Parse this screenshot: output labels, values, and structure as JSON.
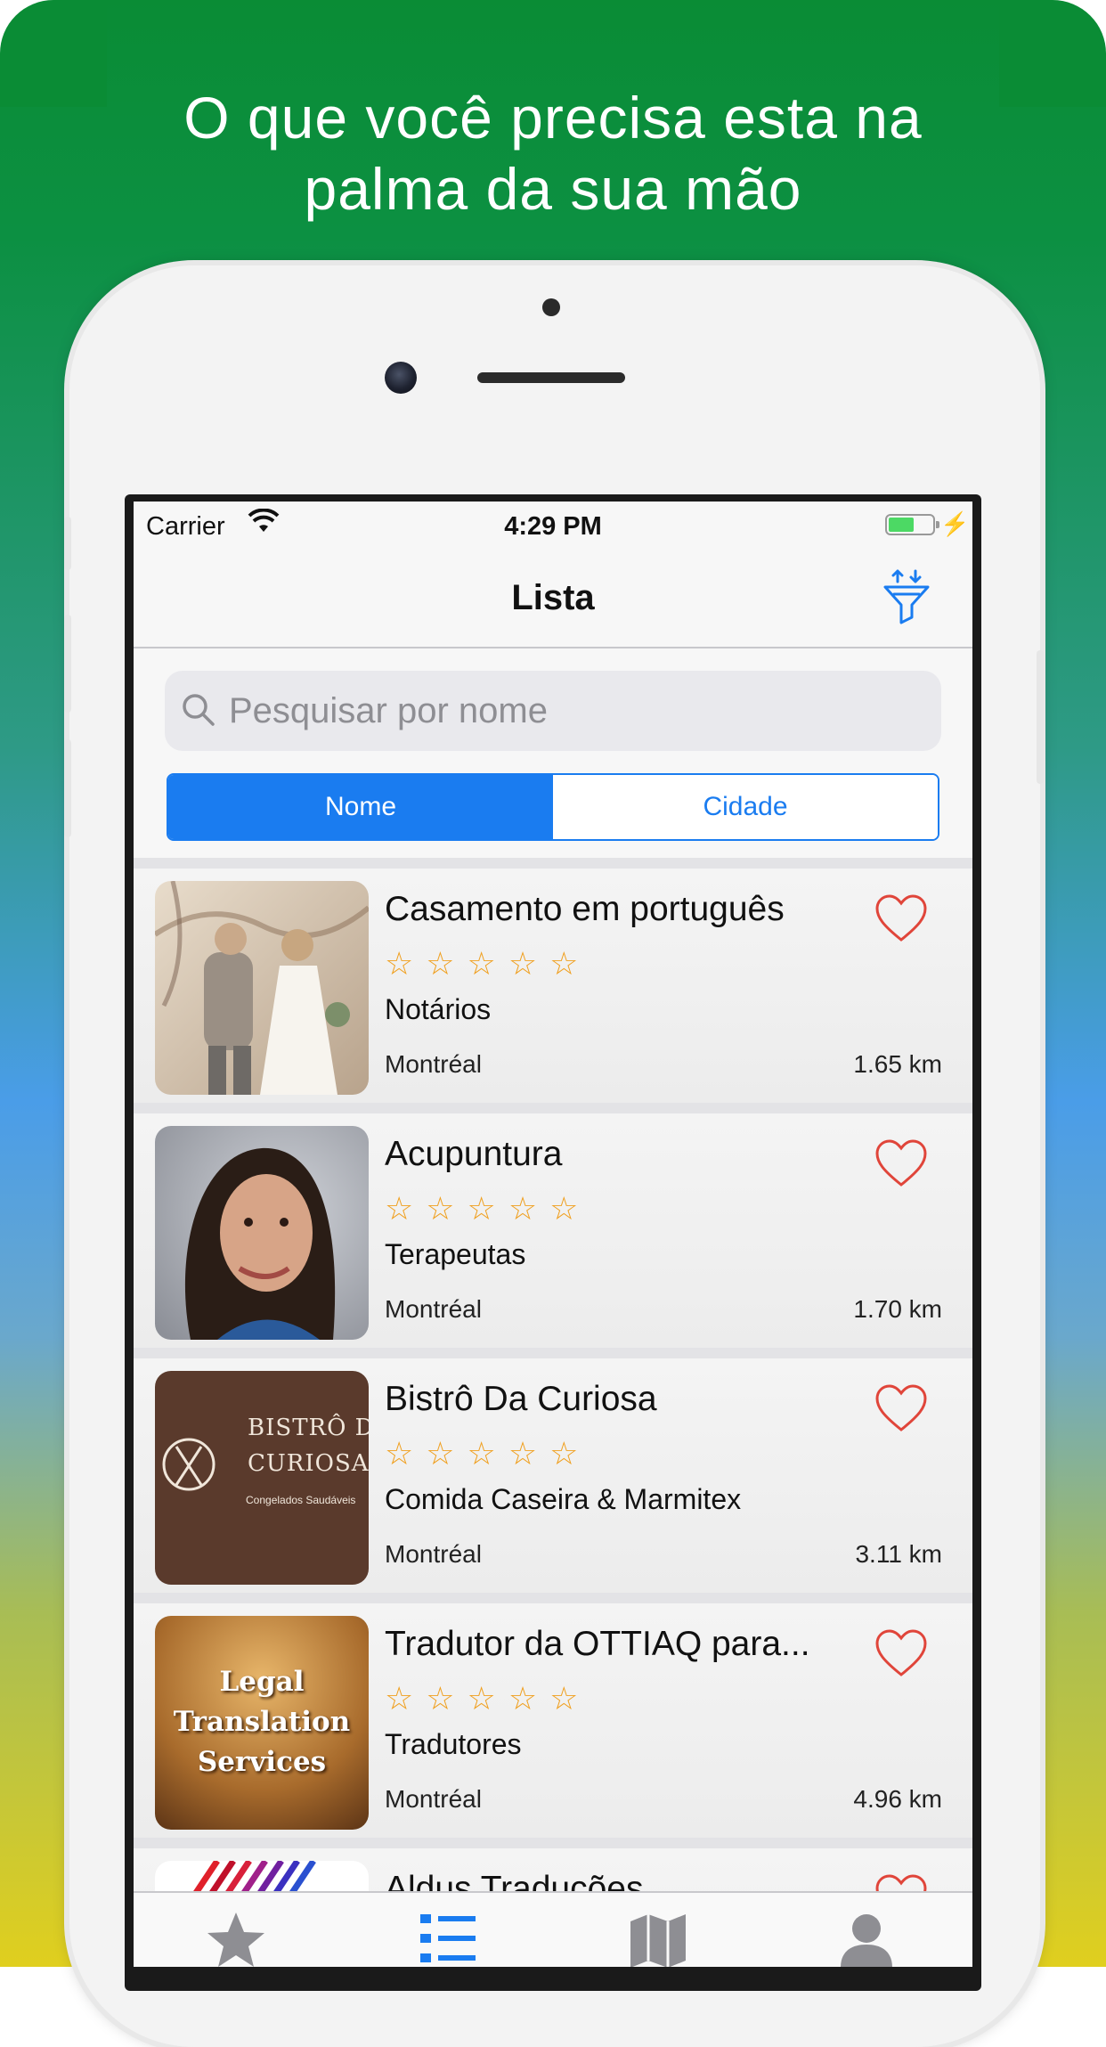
{
  "headline": {
    "line1": "O que você precisa esta na",
    "line2": "palma da sua mão"
  },
  "status_bar": {
    "carrier": "Carrier",
    "time": "4:29 PM"
  },
  "nav": {
    "title": "Lista",
    "filter_icon": "filter-sort-icon"
  },
  "search": {
    "placeholder": "Pesquisar por nome"
  },
  "segments": {
    "name": "Nome",
    "city": "Cidade",
    "selected": "Nome"
  },
  "rating_stars": "☆☆☆☆☆",
  "items": [
    {
      "title": "Casamento em português",
      "category": "Notários",
      "city": "Montréal",
      "distance": "1.65 km"
    },
    {
      "title": "Acupuntura",
      "category": "Terapeutas",
      "city": "Montréal",
      "distance": "1.70 km"
    },
    {
      "title": "Bistrô Da Curiosa",
      "category": "Comida Caseira & Marmitex",
      "city": "Montréal",
      "distance": "3.11 km",
      "logo_text": {
        "line1": "BISTRÔ DA",
        "line2": "CURIOSA",
        "line3": "Congelados Saudáveis"
      }
    },
    {
      "title": "Tradutor da OTTIAQ para...",
      "category": "Tradutores",
      "city": "Montréal",
      "distance": "4.96 km",
      "image_text": {
        "line1": "Legal",
        "line2": "Translation",
        "line3": "Services"
      }
    },
    {
      "title": "Aldus Traduções"
    }
  ],
  "tabs": [
    "star-icon",
    "list-icon",
    "map-icon",
    "profile-icon"
  ],
  "colors": {
    "accent": "#1a7cf0",
    "heart": "#e0453a",
    "stars": "#f0a020",
    "brand_green": "#0a8c35"
  }
}
